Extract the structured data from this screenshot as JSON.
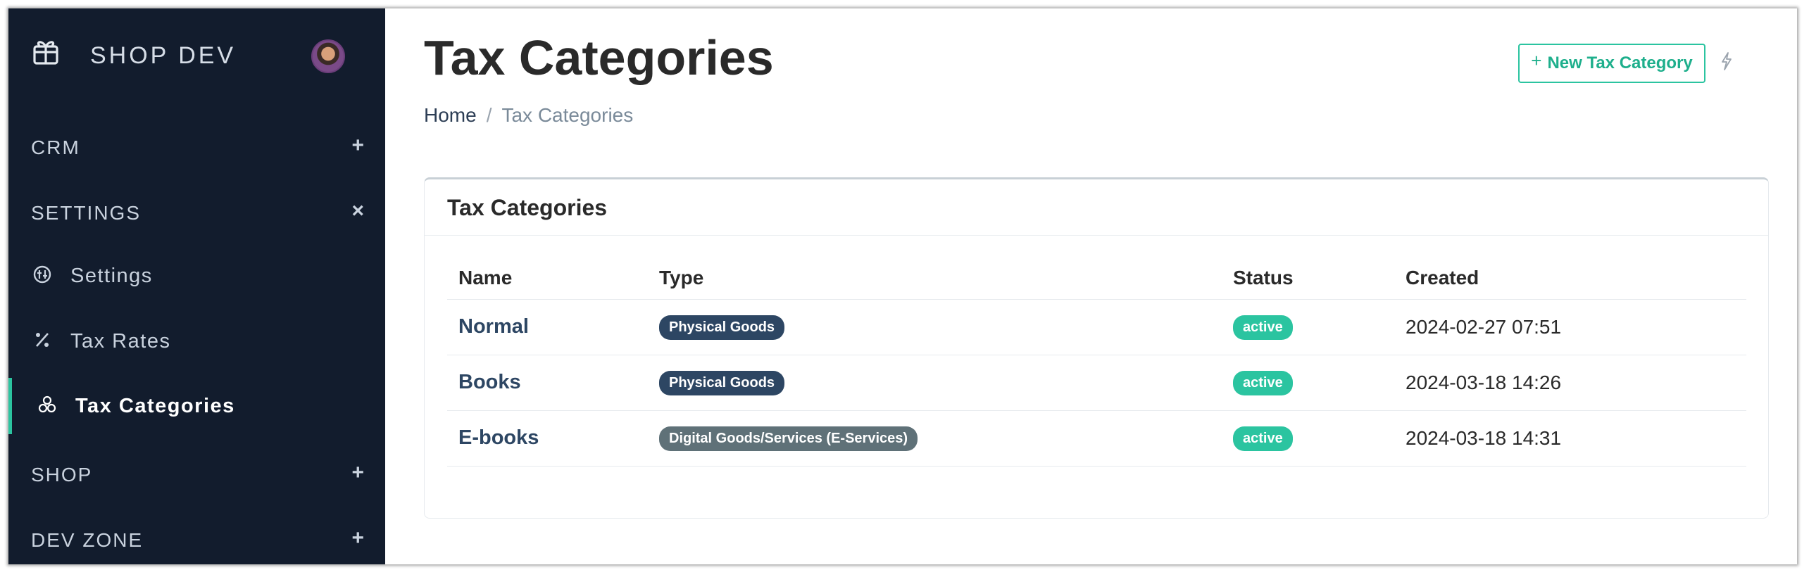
{
  "sidebar": {
    "brand": "SHOP DEV",
    "sections": [
      {
        "label": "CRM",
        "toggle": "+"
      },
      {
        "label": "SETTINGS",
        "toggle": "×"
      },
      {
        "label": "SHOP",
        "toggle": "+"
      },
      {
        "label": "DEV ZONE",
        "toggle": "+"
      }
    ],
    "items": [
      {
        "label": "Settings",
        "icon": "settings-circle-icon"
      },
      {
        "label": "Tax Rates",
        "icon": "percent-icon"
      },
      {
        "label": "Tax Categories",
        "icon": "circles-icon",
        "active": true
      }
    ]
  },
  "header": {
    "title": "Tax Categories",
    "breadcrumb": {
      "home": "Home",
      "separator": "/",
      "current": "Tax Categories"
    },
    "new_button": {
      "plus": "+",
      "label": "New Tax Category"
    }
  },
  "card": {
    "title": "Tax Categories",
    "columns": [
      "Name",
      "Type",
      "Status",
      "Created"
    ],
    "rows": [
      {
        "name": "Normal",
        "type": "Physical Goods",
        "status": "active",
        "created": "2024-02-27 07:51"
      },
      {
        "name": "Books",
        "type": "Physical Goods",
        "status": "active",
        "created": "2024-03-18 14:26"
      },
      {
        "name": "E-books",
        "type": "Digital Goods/Services (E-Services)",
        "status": "active",
        "created": "2024-03-18 14:31"
      }
    ]
  },
  "colors": {
    "sidebar_bg": "#121c2d",
    "accent": "#2bc4a0",
    "physical_badge": "#2d4663",
    "digital_badge": "#5f7178"
  }
}
